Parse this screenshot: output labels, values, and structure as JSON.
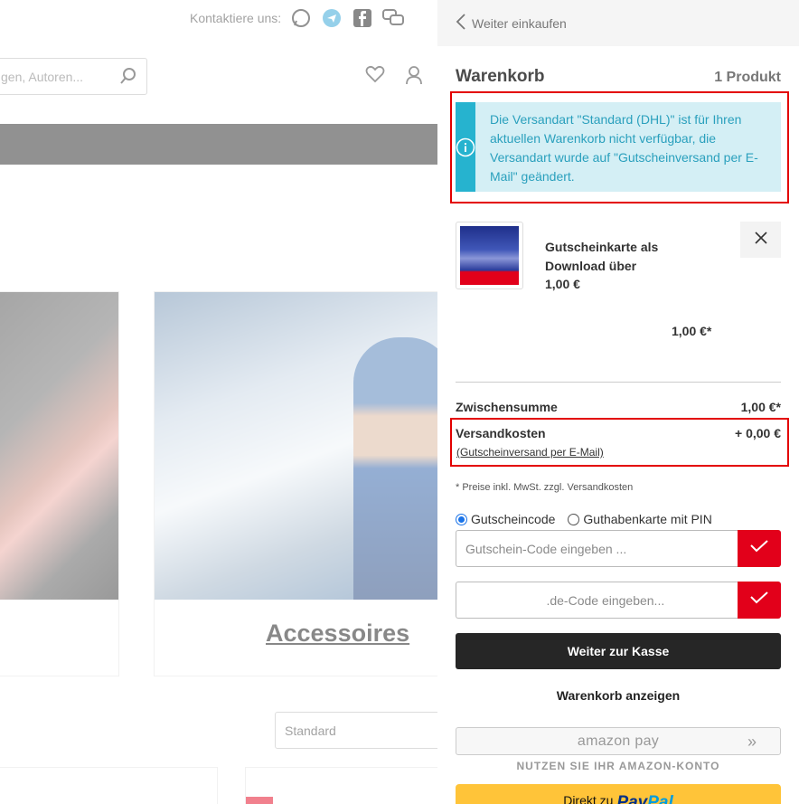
{
  "background": {
    "contact_label": "Kontaktiere uns:",
    "contact_icons": [
      "whatsapp-icon",
      "telegram-icon",
      "facebook-icon",
      "chat-icon"
    ],
    "search_placeholder": "gen, Autoren...",
    "category_label": "Accessoires",
    "sort_value": "Standard"
  },
  "cart": {
    "back_label": "Weiter einkaufen",
    "title": "Warenkorb",
    "count": "1 Produkt",
    "alert_text": "Die Versandart \"Standard (DHL)\" ist für Ihren aktuellen Warenkorb nicht verfügbar, die Versandart wurde auf \"Gutscheinversand per E-Mail\" geändert.",
    "item": {
      "name": "Gutscheinkarte als Download über",
      "price": "1,00 €",
      "total": "1,00 €*"
    },
    "subtotal_label": "Zwischensumme",
    "subtotal_value": "1,00 €*",
    "shipping_label": "Versandkosten",
    "shipping_value": "+ 0,00 €",
    "shipping_method": "(Gutscheinversand per E-Mail)",
    "tax_note": "* Preise inkl. MwSt. zzgl. Versandkosten",
    "radio_voucher": "Gutscheincode",
    "radio_giftcard": "Guthabenkarte mit PIN",
    "voucher_placeholder": "Gutschein-Code eingeben ...",
    "shop_code_placeholder": "                       .de-Code eingeben...",
    "checkout_label": "Weiter zur Kasse",
    "view_cart_label": "Warenkorb anzeigen",
    "amazon_label": "amazon pay",
    "amazon_note": "NUTZEN SIE IHR AMAZON-KONTO",
    "paypal_prefix": "Direkt zu",
    "paypal_word1": "Pay",
    "paypal_word2": "Pal"
  },
  "colors": {
    "accent_red": "#e2001a",
    "info_blue": "#26b3cf",
    "paypal_yellow": "#ffc439"
  }
}
